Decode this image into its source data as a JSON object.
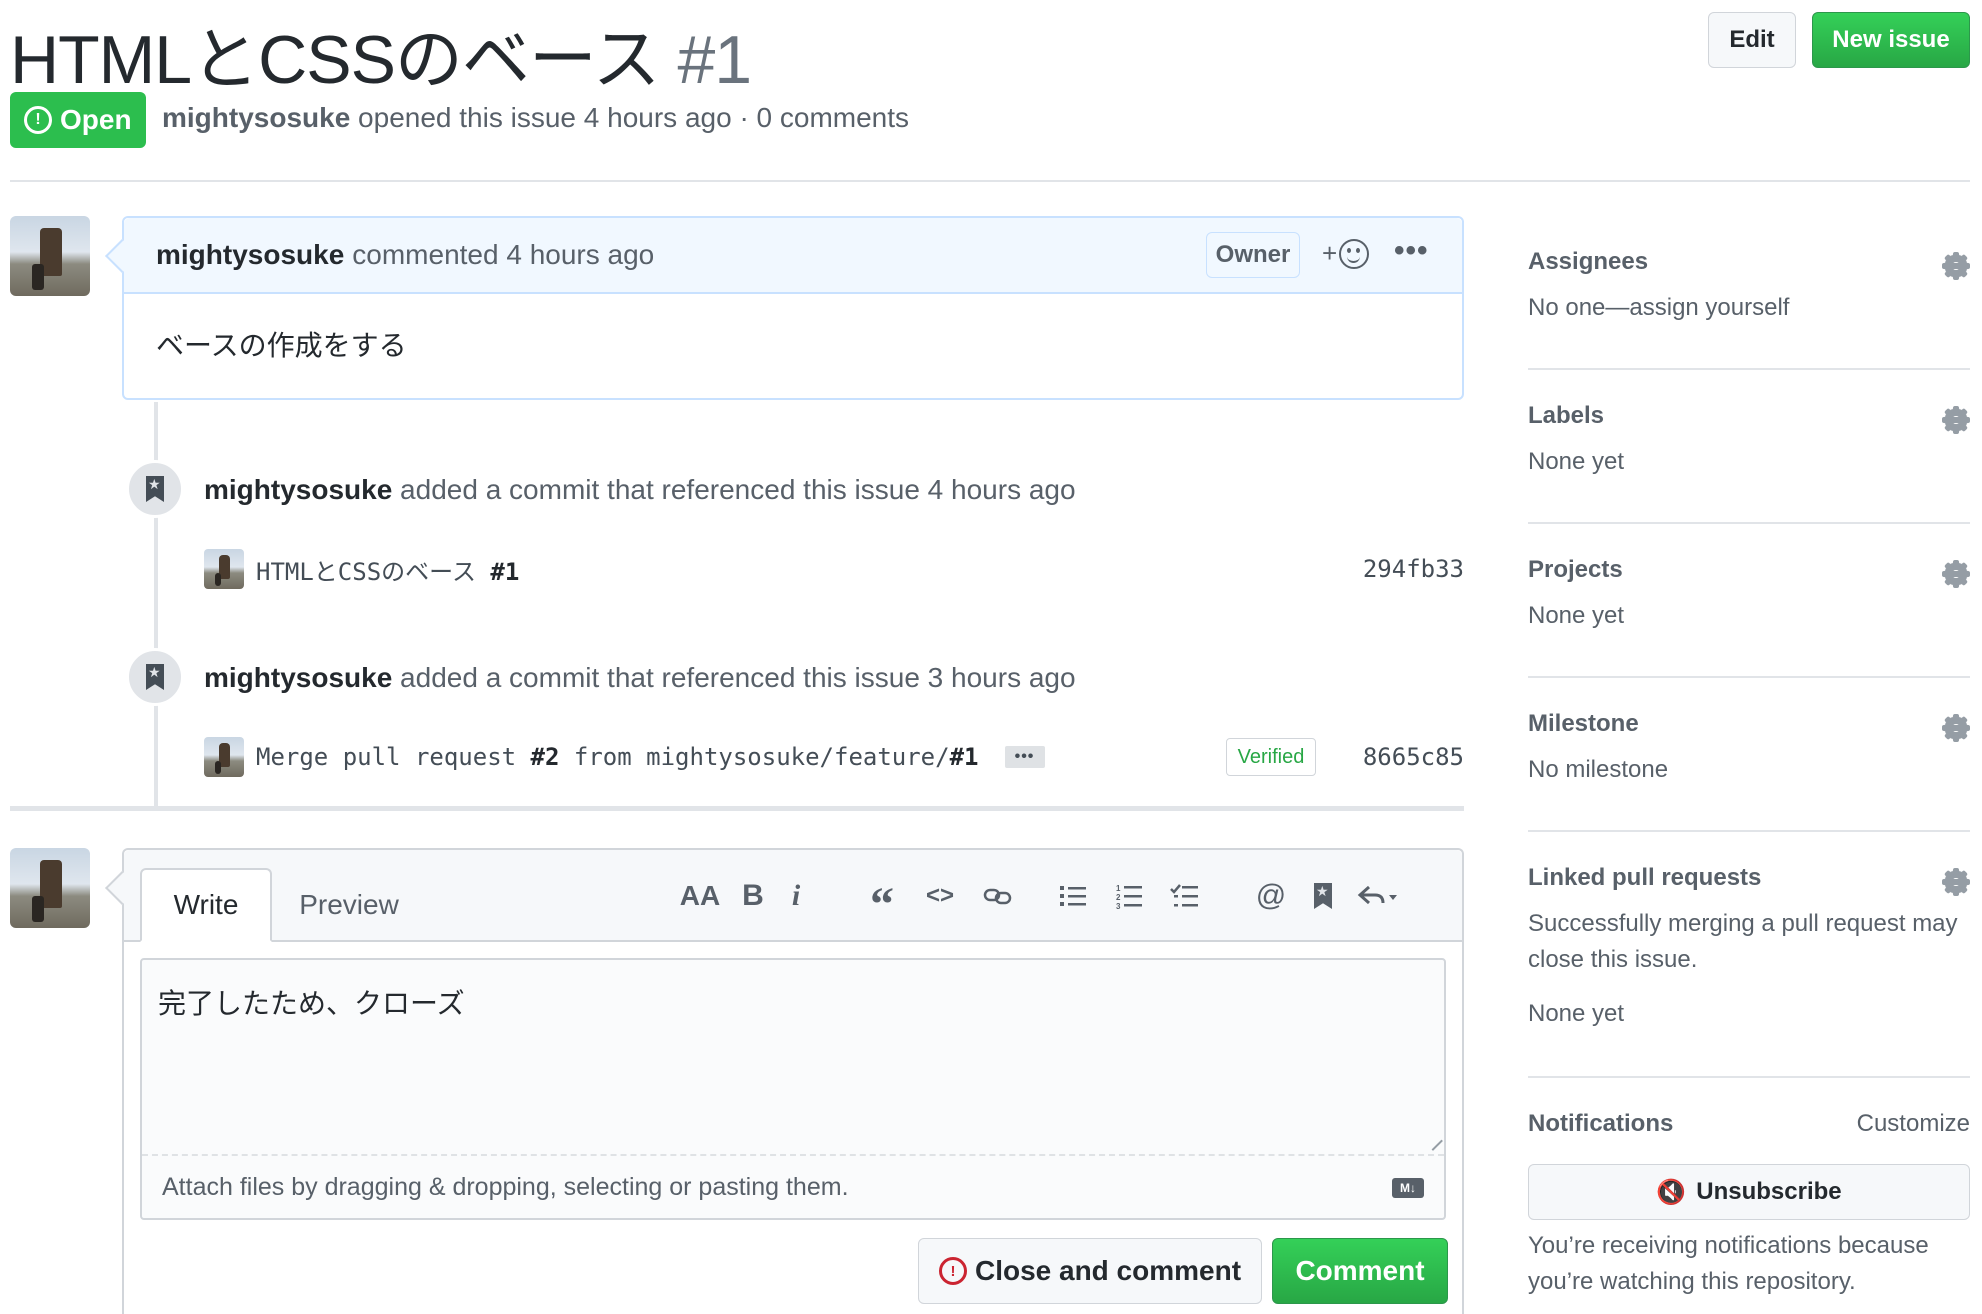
{
  "header": {
    "title": "HTMLとCSSのベース",
    "number": "#1",
    "edit_label": "Edit",
    "new_issue_label": "New issue",
    "state": "Open",
    "author": "mightysosuke",
    "meta_rest": " opened this issue 4 hours ago · 0 comments"
  },
  "comment": {
    "author": "mightysosuke",
    "time": "commented 4 hours ago",
    "role_badge": "Owner",
    "react_plus": "+",
    "more": "•••",
    "body": "ベースの作成をする"
  },
  "timeline": [
    {
      "author": "mightysosuke",
      "text": " added a commit that referenced this issue 4 hours ago",
      "commit_msg": "HTMLとCSSのベース ",
      "commit_ref": "#1",
      "sha": "294fb33"
    },
    {
      "author": "mightysosuke",
      "text": " added a commit that referenced this issue 3 hours ago",
      "commit_msg_a": "Merge pull request ",
      "commit_ref_a": "#2",
      "commit_msg_b": " from mightysosuke/feature/",
      "commit_ref_b": "#1",
      "ellipsis": "•••",
      "verified": "Verified",
      "sha": "8665c85"
    }
  ],
  "form": {
    "tab_write": "Write",
    "tab_preview": "Preview",
    "toolbar": {
      "heading": "AA",
      "bold": "B",
      "italic": "i",
      "quote": "“",
      "code": "<>",
      "mention": "@"
    },
    "textarea_value": "完了したため、クローズ",
    "attach_hint": "Attach files by dragging & dropping, selecting or pasting them.",
    "md_badge": "M↓",
    "close_label": "Close and comment",
    "comment_label": "Comment"
  },
  "sidebar": {
    "assignees_h": "Assignees",
    "assignees_v": "No one—assign yourself",
    "labels_h": "Labels",
    "labels_v": "None yet",
    "projects_h": "Projects",
    "projects_v": "None yet",
    "milestone_h": "Milestone",
    "milestone_v": "No milestone",
    "linked_h": "Linked pull requests",
    "linked_desc_1": "Successfully merging a pull request may",
    "linked_desc_2": "close this issue.",
    "linked_v": "None yet",
    "notifications_h": "Notifications",
    "customize": "Customize",
    "unsubscribe": "Unsubscribe",
    "notify_1": "You’re receiving notifications because",
    "notify_2": "you’re watching this repository."
  },
  "colors": {
    "green": "#2cbe4e",
    "blue_header": "#f1f8ff",
    "text_muted": "#586069"
  },
  "icons": [
    "alert-circle-icon",
    "smiley-icon",
    "kebab-icon",
    "bookmark-icon",
    "gear-icon",
    "mute-icon",
    "close-issue-icon",
    "markdown-icon"
  ]
}
